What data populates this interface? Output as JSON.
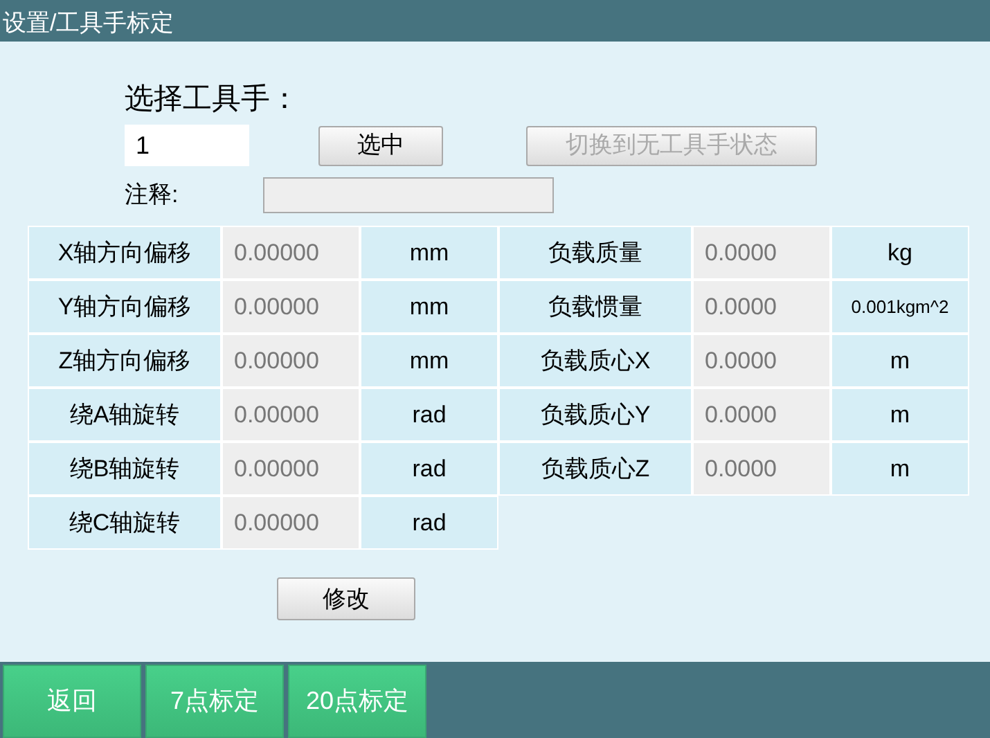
{
  "title": "设置/工具手标定",
  "tool_select": {
    "label": "选择工具手：",
    "value": "1",
    "select_button": "选中",
    "switch_button": {
      "label": "切换到无工具手状态",
      "disabled": true
    }
  },
  "comment": {
    "label": "注释:"
  },
  "left_params": [
    {
      "label": "X轴方向偏移",
      "value": "0.00000",
      "unit": "mm"
    },
    {
      "label": "Y轴方向偏移",
      "value": "0.00000",
      "unit": "mm"
    },
    {
      "label": "Z轴方向偏移",
      "value": "0.00000",
      "unit": "mm"
    },
    {
      "label": "绕A轴旋转",
      "value": "0.00000",
      "unit": "rad"
    },
    {
      "label": "绕B轴旋转",
      "value": "0.00000",
      "unit": "rad"
    },
    {
      "label": "绕C轴旋转",
      "value": "0.00000",
      "unit": "rad"
    }
  ],
  "right_params": [
    {
      "label": "负载质量",
      "value": "0.0000",
      "unit": "kg"
    },
    {
      "label": "负载惯量",
      "value": "0.0000",
      "unit": "0.001kgm^2"
    },
    {
      "label": "负载质心X",
      "value": "0.0000",
      "unit": "m"
    },
    {
      "label": "负载质心Y",
      "value": "0.0000",
      "unit": "m"
    },
    {
      "label": "负载质心Z",
      "value": "0.0000",
      "unit": "m"
    }
  ],
  "modify_button": "修改",
  "bottom_buttons": [
    "返回",
    "7点标定",
    "20点标定"
  ]
}
